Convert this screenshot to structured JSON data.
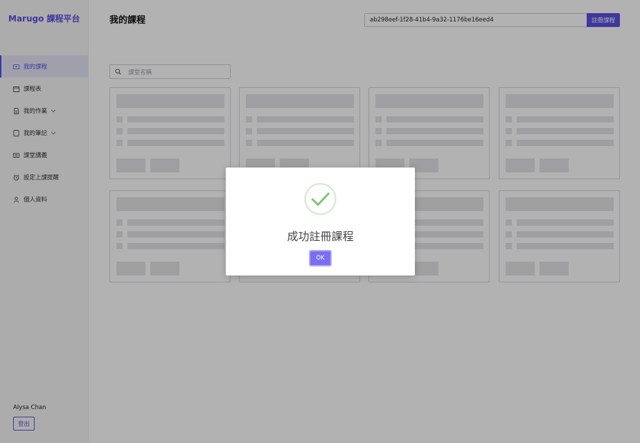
{
  "app": {
    "brand": "Marugo 課程平台"
  },
  "sidebar": {
    "items": [
      {
        "label": "我的課程",
        "icon": "play-icon",
        "active": true
      },
      {
        "label": "課程表",
        "icon": "calendar-icon"
      },
      {
        "label": "我的作業",
        "icon": "document-icon",
        "expandable": true
      },
      {
        "label": "我的筆記",
        "icon": "notebook-icon",
        "expandable": true
      },
      {
        "label": "課堂講義",
        "icon": "slides-icon"
      },
      {
        "label": "設定上課提醒",
        "icon": "alarm-icon"
      },
      {
        "label": "個人資料",
        "icon": "user-icon"
      }
    ],
    "user_name": "Alysa Chan",
    "logout_label": "登出"
  },
  "header": {
    "title": "我的課程",
    "course_code_value": "ab298eef-1f28-41b4-9a32-1176be16eed4",
    "enroll_label": "註冊課程"
  },
  "search": {
    "placeholder": "課堂名稱"
  },
  "modal": {
    "message": "成功註冊課程",
    "ok_label": "OK",
    "icon": "checkmark-circle-icon"
  },
  "colors": {
    "accent": "#5b4fe0",
    "success": "#7cc46b"
  }
}
